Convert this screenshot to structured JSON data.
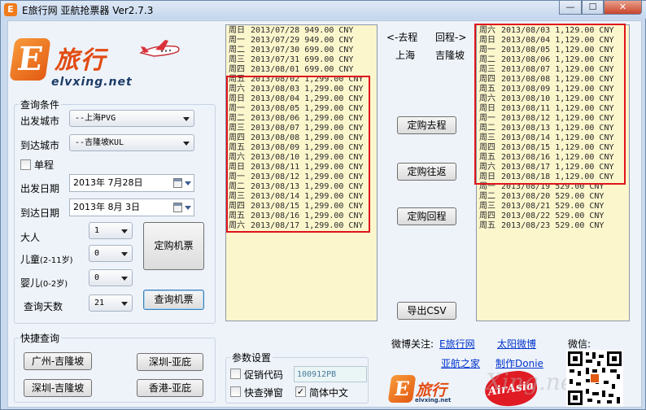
{
  "window": {
    "title": "E旅行网 亚航抢票器 Ver2.7.3",
    "app_icon": "E",
    "minimize": "—",
    "maximize": "☐",
    "close": "✕"
  },
  "logo": {
    "letter": "E",
    "cn": "旅行",
    "en": "elvxing.net"
  },
  "query": {
    "title": "查询条件",
    "from_label": "出发城市",
    "from_value": "--上海PVG",
    "to_label": "到达城市",
    "to_value": "--吉隆坡KUL",
    "oneway_label": "单程",
    "depart_label": "出发日期",
    "depart_value": "2013年  7月28日",
    "arrive_label": "到达日期",
    "arrive_value": "2013年  8月  3日",
    "adult_label": "大人",
    "adult_value": "1",
    "child_label": "儿童",
    "child_hint": "(2-11岁)",
    "child_value": "0",
    "infant_label": "婴儿",
    "infant_hint": "(0-2岁)",
    "infant_value": "0",
    "days_label": "查询天数",
    "days_value": "21",
    "book_button": "定购机票",
    "search_button": "查询机票"
  },
  "quick": {
    "title": "快捷查询",
    "buttons": [
      "广州-吉隆坡",
      "深圳-亚庇",
      "深圳-吉隆坡",
      "香港-亚庇"
    ]
  },
  "params": {
    "title": "参数设置",
    "promo_label": "促销代码",
    "promo_value": "100912PB",
    "quick_popup_label": "快查弹窗",
    "simplified_label": "简体中文",
    "simplified_checked": "✓"
  },
  "center": {
    "go_arrow": "<-去程",
    "return_arrow": "回程->",
    "go_city": "上海",
    "return_city": "吉隆坡",
    "book_go": "定购去程",
    "book_roundtrip": "定购往返",
    "book_return": "定购回程",
    "export_csv": "导出CSV"
  },
  "outbound": [
    {
      "wd": "周日",
      "date": "2013/07/28",
      "price": "949.00 CNY"
    },
    {
      "wd": "周一",
      "date": "2013/07/29",
      "price": "949.00 CNY"
    },
    {
      "wd": "周二",
      "date": "2013/07/30",
      "price": "699.00 CNY"
    },
    {
      "wd": "周三",
      "date": "2013/07/31",
      "price": "699.00 CNY"
    },
    {
      "wd": "周四",
      "date": "2013/08/01",
      "price": "699.00 CNY"
    },
    {
      "wd": "周五",
      "date": "2013/08/02",
      "price": "1,299.00 CNY"
    },
    {
      "wd": "周六",
      "date": "2013/08/03",
      "price": "1,299.00 CNY"
    },
    {
      "wd": "周日",
      "date": "2013/08/04",
      "price": "1,299.00 CNY"
    },
    {
      "wd": "周一",
      "date": "2013/08/05",
      "price": "1,299.00 CNY"
    },
    {
      "wd": "周二",
      "date": "2013/08/06",
      "price": "1,299.00 CNY"
    },
    {
      "wd": "周三",
      "date": "2013/08/07",
      "price": "1,299.00 CNY"
    },
    {
      "wd": "周四",
      "date": "2013/08/08",
      "price": "1,299.00 CNY"
    },
    {
      "wd": "周五",
      "date": "2013/08/09",
      "price": "1,299.00 CNY"
    },
    {
      "wd": "周六",
      "date": "2013/08/10",
      "price": "1,299.00 CNY"
    },
    {
      "wd": "周日",
      "date": "2013/08/11",
      "price": "1,299.00 CNY"
    },
    {
      "wd": "周一",
      "date": "2013/08/12",
      "price": "1,299.00 CNY"
    },
    {
      "wd": "周二",
      "date": "2013/08/13",
      "price": "1,299.00 CNY"
    },
    {
      "wd": "周三",
      "date": "2013/08/14",
      "price": "1,299.00 CNY"
    },
    {
      "wd": "周四",
      "date": "2013/08/15",
      "price": "1,299.00 CNY"
    },
    {
      "wd": "周五",
      "date": "2013/08/16",
      "price": "1,299.00 CNY"
    },
    {
      "wd": "周六",
      "date": "2013/08/17",
      "price": "1,299.00 CNY"
    }
  ],
  "inbound": [
    {
      "wd": "周六",
      "date": "2013/08/03",
      "price": "1,129.00 CNY"
    },
    {
      "wd": "周日",
      "date": "2013/08/04",
      "price": "1,129.00 CNY"
    },
    {
      "wd": "周一",
      "date": "2013/08/05",
      "price": "1,129.00 CNY"
    },
    {
      "wd": "周二",
      "date": "2013/08/06",
      "price": "1,129.00 CNY"
    },
    {
      "wd": "周三",
      "date": "2013/08/07",
      "price": "1,129.00 CNY"
    },
    {
      "wd": "周四",
      "date": "2013/08/08",
      "price": "1,129.00 CNY"
    },
    {
      "wd": "周五",
      "date": "2013/08/09",
      "price": "1,129.00 CNY"
    },
    {
      "wd": "周六",
      "date": "2013/08/10",
      "price": "1,129.00 CNY"
    },
    {
      "wd": "周日",
      "date": "2013/08/11",
      "price": "1,129.00 CNY"
    },
    {
      "wd": "周一",
      "date": "2013/08/12",
      "price": "1,129.00 CNY"
    },
    {
      "wd": "周二",
      "date": "2013/08/13",
      "price": "1,129.00 CNY"
    },
    {
      "wd": "周三",
      "date": "2013/08/14",
      "price": "1,129.00 CNY"
    },
    {
      "wd": "周四",
      "date": "2013/08/15",
      "price": "1,129.00 CNY"
    },
    {
      "wd": "周五",
      "date": "2013/08/16",
      "price": "1,129.00 CNY"
    },
    {
      "wd": "周六",
      "date": "2013/08/17",
      "price": "1,129.00 CNY"
    },
    {
      "wd": "周日",
      "date": "2013/08/18",
      "price": "1,129.00 CNY"
    },
    {
      "wd": "周一",
      "date": "2013/08/19",
      "price": "529.00 CNY"
    },
    {
      "wd": "周二",
      "date": "2013/08/20",
      "price": "529.00 CNY"
    },
    {
      "wd": "周三",
      "date": "2013/08/21",
      "price": "529.00 CNY"
    },
    {
      "wd": "周四",
      "date": "2013/08/22",
      "price": "529.00 CNY"
    },
    {
      "wd": "周五",
      "date": "2013/08/23",
      "price": "529.00 CNY"
    }
  ],
  "footer": {
    "weibo_label": "微博关注:",
    "link_elvxing": "E旅行网",
    "link_taiyang": "太阳微博",
    "link_yahang": "亚航之家",
    "link_zuozhe": "制作Donie",
    "wechat_label": "微信:",
    "logo_letter": "E",
    "logo_cn": "旅行",
    "logo_en": "elvxing.net",
    "airasia": "AirAsia",
    "watermark": "Xing.net"
  },
  "colors": {
    "list_bg": "#fcf6cd",
    "highlight": "#e0141b",
    "brand_orange": "#e35a12",
    "link": "#0033cc"
  }
}
